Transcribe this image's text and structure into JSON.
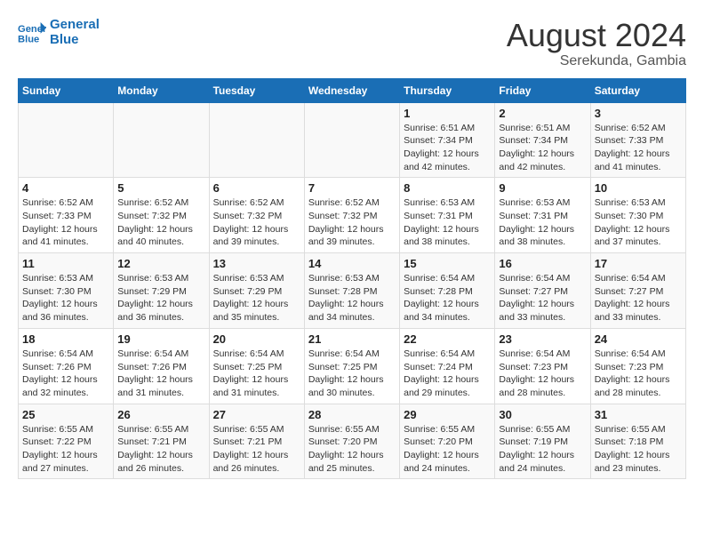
{
  "header": {
    "logo_line1": "General",
    "logo_line2": "Blue",
    "title": "August 2024",
    "subtitle": "Serekunda, Gambia"
  },
  "weekdays": [
    "Sunday",
    "Monday",
    "Tuesday",
    "Wednesday",
    "Thursday",
    "Friday",
    "Saturday"
  ],
  "weeks": [
    [
      {
        "day": "",
        "empty": true
      },
      {
        "day": "",
        "empty": true
      },
      {
        "day": "",
        "empty": true
      },
      {
        "day": "",
        "empty": true
      },
      {
        "day": "1",
        "sunrise": "6:51 AM",
        "sunset": "7:34 PM",
        "daylight": "12 hours and 42 minutes."
      },
      {
        "day": "2",
        "sunrise": "6:51 AM",
        "sunset": "7:34 PM",
        "daylight": "12 hours and 42 minutes."
      },
      {
        "day": "3",
        "sunrise": "6:52 AM",
        "sunset": "7:33 PM",
        "daylight": "12 hours and 41 minutes."
      }
    ],
    [
      {
        "day": "4",
        "sunrise": "6:52 AM",
        "sunset": "7:33 PM",
        "daylight": "12 hours and 41 minutes."
      },
      {
        "day": "5",
        "sunrise": "6:52 AM",
        "sunset": "7:32 PM",
        "daylight": "12 hours and 40 minutes."
      },
      {
        "day": "6",
        "sunrise": "6:52 AM",
        "sunset": "7:32 PM",
        "daylight": "12 hours and 39 minutes."
      },
      {
        "day": "7",
        "sunrise": "6:52 AM",
        "sunset": "7:32 PM",
        "daylight": "12 hours and 39 minutes."
      },
      {
        "day": "8",
        "sunrise": "6:53 AM",
        "sunset": "7:31 PM",
        "daylight": "12 hours and 38 minutes."
      },
      {
        "day": "9",
        "sunrise": "6:53 AM",
        "sunset": "7:31 PM",
        "daylight": "12 hours and 38 minutes."
      },
      {
        "day": "10",
        "sunrise": "6:53 AM",
        "sunset": "7:30 PM",
        "daylight": "12 hours and 37 minutes."
      }
    ],
    [
      {
        "day": "11",
        "sunrise": "6:53 AM",
        "sunset": "7:30 PM",
        "daylight": "12 hours and 36 minutes."
      },
      {
        "day": "12",
        "sunrise": "6:53 AM",
        "sunset": "7:29 PM",
        "daylight": "12 hours and 36 minutes."
      },
      {
        "day": "13",
        "sunrise": "6:53 AM",
        "sunset": "7:29 PM",
        "daylight": "12 hours and 35 minutes."
      },
      {
        "day": "14",
        "sunrise": "6:53 AM",
        "sunset": "7:28 PM",
        "daylight": "12 hours and 34 minutes."
      },
      {
        "day": "15",
        "sunrise": "6:54 AM",
        "sunset": "7:28 PM",
        "daylight": "12 hours and 34 minutes."
      },
      {
        "day": "16",
        "sunrise": "6:54 AM",
        "sunset": "7:27 PM",
        "daylight": "12 hours and 33 minutes."
      },
      {
        "day": "17",
        "sunrise": "6:54 AM",
        "sunset": "7:27 PM",
        "daylight": "12 hours and 33 minutes."
      }
    ],
    [
      {
        "day": "18",
        "sunrise": "6:54 AM",
        "sunset": "7:26 PM",
        "daylight": "12 hours and 32 minutes."
      },
      {
        "day": "19",
        "sunrise": "6:54 AM",
        "sunset": "7:26 PM",
        "daylight": "12 hours and 31 minutes."
      },
      {
        "day": "20",
        "sunrise": "6:54 AM",
        "sunset": "7:25 PM",
        "daylight": "12 hours and 31 minutes."
      },
      {
        "day": "21",
        "sunrise": "6:54 AM",
        "sunset": "7:25 PM",
        "daylight": "12 hours and 30 minutes."
      },
      {
        "day": "22",
        "sunrise": "6:54 AM",
        "sunset": "7:24 PM",
        "daylight": "12 hours and 29 minutes."
      },
      {
        "day": "23",
        "sunrise": "6:54 AM",
        "sunset": "7:23 PM",
        "daylight": "12 hours and 28 minutes."
      },
      {
        "day": "24",
        "sunrise": "6:54 AM",
        "sunset": "7:23 PM",
        "daylight": "12 hours and 28 minutes."
      }
    ],
    [
      {
        "day": "25",
        "sunrise": "6:55 AM",
        "sunset": "7:22 PM",
        "daylight": "12 hours and 27 minutes."
      },
      {
        "day": "26",
        "sunrise": "6:55 AM",
        "sunset": "7:21 PM",
        "daylight": "12 hours and 26 minutes."
      },
      {
        "day": "27",
        "sunrise": "6:55 AM",
        "sunset": "7:21 PM",
        "daylight": "12 hours and 26 minutes."
      },
      {
        "day": "28",
        "sunrise": "6:55 AM",
        "sunset": "7:20 PM",
        "daylight": "12 hours and 25 minutes."
      },
      {
        "day": "29",
        "sunrise": "6:55 AM",
        "sunset": "7:20 PM",
        "daylight": "12 hours and 24 minutes."
      },
      {
        "day": "30",
        "sunrise": "6:55 AM",
        "sunset": "7:19 PM",
        "daylight": "12 hours and 24 minutes."
      },
      {
        "day": "31",
        "sunrise": "6:55 AM",
        "sunset": "7:18 PM",
        "daylight": "12 hours and 23 minutes."
      }
    ]
  ],
  "labels": {
    "sunrise_prefix": "Sunrise: ",
    "sunset_prefix": "Sunset: ",
    "daylight_prefix": "Daylight: "
  }
}
